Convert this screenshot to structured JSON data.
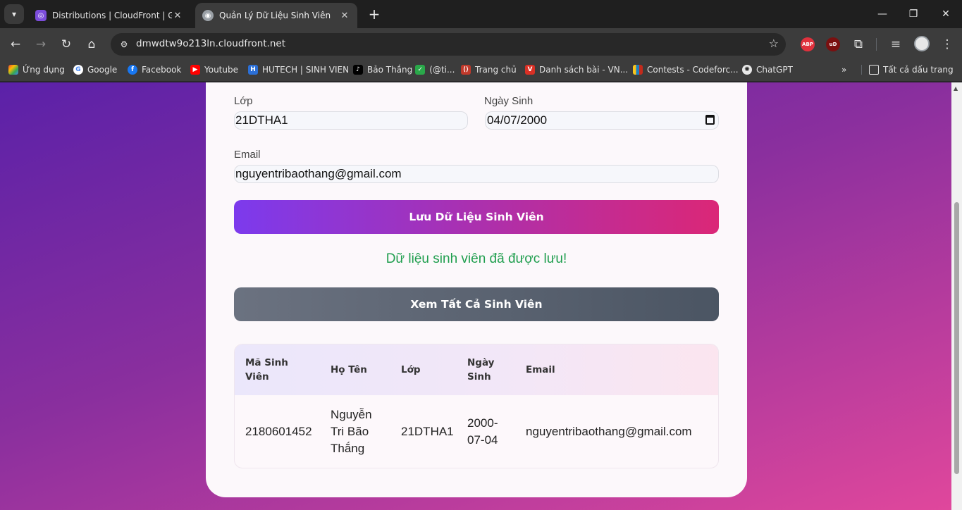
{
  "browser": {
    "tabs": [
      {
        "title": "Distributions | CloudFront | Glo",
        "favicon": "cloudfront-icon",
        "active": false
      },
      {
        "title": "Quản Lý Dữ Liệu Sinh Viên",
        "favicon": "globe-icon",
        "active": true
      }
    ],
    "url": "dmwdtw9o213ln.cloudfront.net",
    "extensions": {
      "abp": "ABP",
      "ublock": "uD"
    },
    "bookmarks": [
      {
        "label": "Ứng dụng",
        "icon": "apps-grid-icon"
      },
      {
        "label": "Google",
        "icon": "google-icon"
      },
      {
        "label": "Facebook",
        "icon": "facebook-icon"
      },
      {
        "label": "Youtube",
        "icon": "youtube-icon"
      },
      {
        "label": "HUTECH | SINH VIEN",
        "icon": "hutech-icon"
      },
      {
        "label": "Bảo Thắng",
        "icon": "tiktok-icon"
      },
      {
        "label": "(@ti...",
        "icon": "checkmark-icon"
      },
      {
        "label": "Trang chủ",
        "icon": "page-icon"
      },
      {
        "label": "Danh sách bài - VN...",
        "icon": "vnoi-icon"
      },
      {
        "label": "Contests - Codeforc...",
        "icon": "codeforces-icon"
      },
      {
        "label": "ChatGPT",
        "icon": "chatgpt-icon"
      }
    ],
    "all_bookmarks_label": "Tất cả dấu trang"
  },
  "form": {
    "class_label": "Lớp",
    "class_value": "21DTHA1",
    "dob_label": "Ngày Sinh",
    "dob_value": "04/07/2000",
    "email_label": "Email",
    "email_value": "nguyentribaothang@gmail.com",
    "save_button": "Lưu Dữ Liệu Sinh Viên",
    "success_message": "Dữ liệu sinh viên đã được lưu!",
    "view_all_button": "Xem Tất Cả Sinh Viên"
  },
  "table": {
    "headers": [
      "Mã Sinh Viên",
      "Họ Tên",
      "Lớp",
      "Ngày Sinh",
      "Email"
    ],
    "rows": [
      {
        "id": "2180601452",
        "name": "Nguyễn Tri Bão Thắng",
        "class": "21DTHA1",
        "dob": "2000-07-04",
        "email": "nguyentribaothang@gmail.com"
      }
    ]
  },
  "colors": {
    "primary_gradient_start": "#7c3aed",
    "primary_gradient_end": "#db2777",
    "success": "#1f9e4e",
    "secondary": "#4b5563"
  }
}
